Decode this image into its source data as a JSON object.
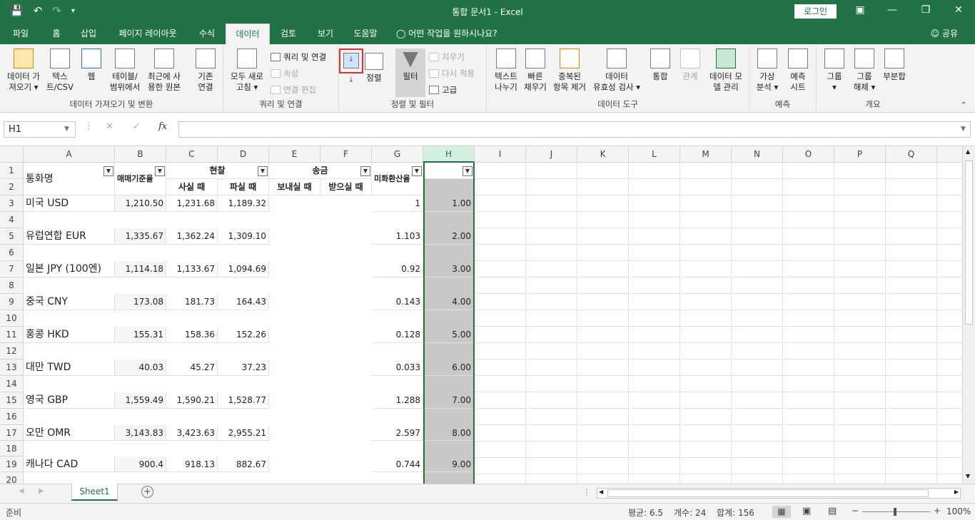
{
  "titlebar": {
    "title": "통합 문서1 - Excel",
    "login": "로그인",
    "icons": [
      "save-icon",
      "undo-icon",
      "redo-icon",
      "customize-qat-icon"
    ]
  },
  "menu": {
    "tabs": [
      "파일",
      "홈",
      "삽입",
      "페이지 레이아웃",
      "수식",
      "데이터",
      "검토",
      "보기",
      "도움말"
    ],
    "active": "데이터",
    "tell_me": "어떤 작업을 원하시나요?",
    "share": "공유"
  },
  "ribbon": {
    "group1": {
      "label": "데이터 가져오기 및 변환",
      "b1": "데이터 가\n져오기 ▾",
      "b2": "텍스\n트/CSV",
      "b3": "웹",
      "b4": "테이블/\n범위에서",
      "b5": "최근에 사\n용한 원본",
      "b6": "기존\n연결"
    },
    "group2": {
      "label": "쿼리 및 연결",
      "refresh": "모두 새로\n고침 ▾",
      "queries": "쿼리 및 연결",
      "props": "속성",
      "edit_links": "연결 편집"
    },
    "group3": {
      "label": "정렬 및 필터",
      "sort_asc": "",
      "sort_desc": "",
      "sort": "정렬",
      "filter": "필터",
      "clear": "지우기",
      "reapply": "다시 적용",
      "advanced": "고급"
    },
    "group4": {
      "label": "데이터 도구",
      "t2c": "텍스트\n나누기",
      "flash": "빠른\n채우기",
      "dup": "중복된\n항목 제거",
      "valid": "데이터\n유효성 검사 ▾",
      "consol": "통합",
      "rel": "관계",
      "model": "데이터 모\n델 관리"
    },
    "group5": {
      "label": "예측",
      "whatif": "가상\n분석 ▾",
      "forecast": "예측\n시트"
    },
    "group6": {
      "label": "개요",
      "group": "그룹\n▾",
      "ungroup": "그룹\n해제 ▾",
      "subtotal": "부분합"
    }
  },
  "formula": {
    "namebox": "H1",
    "fx": "fx",
    "value": ""
  },
  "sheet": {
    "columns": [
      "A",
      "B",
      "C",
      "D",
      "E",
      "F",
      "G",
      "H",
      "I",
      "J",
      "K",
      "L",
      "M",
      "N",
      "O",
      "P",
      "Q"
    ],
    "rows": [
      "1",
      "2",
      "3",
      "4",
      "5",
      "6",
      "7",
      "8",
      "9",
      "10",
      "11",
      "12",
      "13",
      "14",
      "15",
      "16",
      "17",
      "18",
      "19",
      "20"
    ],
    "header": {
      "currency": "통화명",
      "base": "매매기준율",
      "cash": "현찰",
      "buy": "사실 때",
      "sell": "파실 때",
      "transfer": "송금",
      "send": "보내실 때",
      "receive": "받으실 때",
      "usd_rate": "미화환산율"
    },
    "data": [
      {
        "name": "미국 USD",
        "b": "1,210.50",
        "c": "1,231.68",
        "d": "1,189.32",
        "g": "1",
        "h": "1.00"
      },
      {
        "name": "유럽연합 EUR",
        "b": "1,335.67",
        "c": "1,362.24",
        "d": "1,309.10",
        "g": "1.103",
        "h": "2.00"
      },
      {
        "name": "일본 JPY (100엔)",
        "b": "1,114.18",
        "c": "1,133.67",
        "d": "1,094.69",
        "g": "0.92",
        "h": "3.00"
      },
      {
        "name": "중국 CNY",
        "b": "173.08",
        "c": "181.73",
        "d": "164.43",
        "g": "0.143",
        "h": "4.00"
      },
      {
        "name": "홍콩 HKD",
        "b": "155.31",
        "c": "158.36",
        "d": "152.26",
        "g": "0.128",
        "h": "5.00"
      },
      {
        "name": "대만 TWD",
        "b": "40.03",
        "c": "45.27",
        "d": "37.23",
        "g": "0.033",
        "h": "6.00"
      },
      {
        "name": "영국 GBP",
        "b": "1,559.49",
        "c": "1,590.21",
        "d": "1,528.77",
        "g": "1.288",
        "h": "7.00"
      },
      {
        "name": "오만 OMR",
        "b": "3,143.83",
        "c": "3,423.63",
        "d": "2,955.21",
        "g": "2.597",
        "h": "8.00"
      },
      {
        "name": "캐나다 CAD",
        "b": "900.4",
        "c": "918.13",
        "d": "882.67",
        "g": "0.744",
        "h": "9.00"
      }
    ]
  },
  "sheettab": "Sheet1",
  "status": {
    "ready": "준비",
    "avg": "평균: 6.5",
    "count": "개수: 24",
    "sum": "합계: 156",
    "zoom": "100%"
  }
}
